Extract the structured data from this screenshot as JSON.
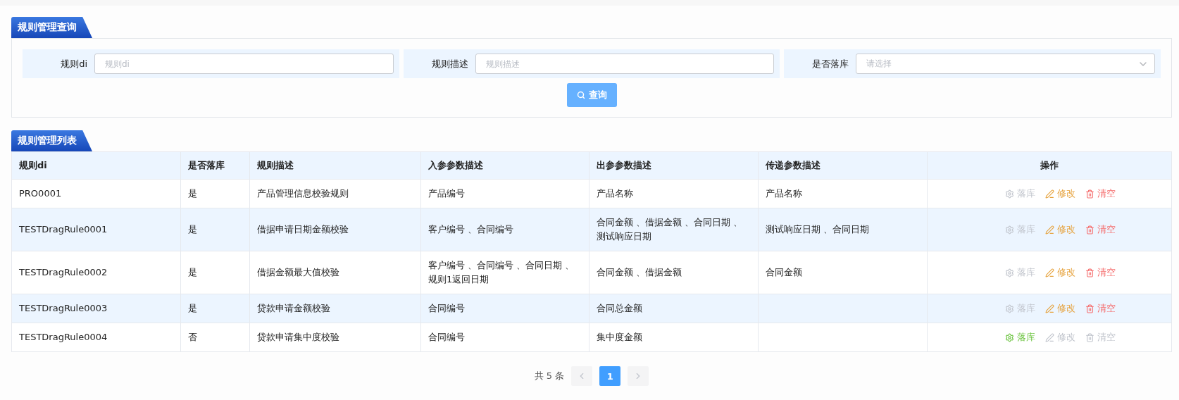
{
  "query_section": {
    "title": "规则管理查询",
    "fields": [
      {
        "kind": "input",
        "label": "规则di",
        "placeholder": "规则di"
      },
      {
        "kind": "input",
        "label": "规则描述",
        "placeholder": "规则描述"
      },
      {
        "kind": "select",
        "label": "是否落库",
        "placeholder": "请选择"
      }
    ],
    "search_button": "查询"
  },
  "list_section": {
    "title": "规则管理列表",
    "table": {
      "columns": [
        "规则di",
        "是否落库",
        "规则描述",
        "入参参数描述",
        "出参参数描述",
        "传递参数描述",
        "操作"
      ],
      "rows": [
        {
          "cells": [
            "PRO0001",
            "是",
            "产品管理信息校验规则",
            "产品编号",
            "产品名称",
            "产品名称"
          ],
          "actions": [
            {
              "kind": "store",
              "label": "落库",
              "disabled": true
            },
            {
              "kind": "edit",
              "label": "修改",
              "disabled": false
            },
            {
              "kind": "clear",
              "label": "清空",
              "disabled": false
            }
          ]
        },
        {
          "cells": [
            "TESTDragRule0001",
            "是",
            "借据申请日期金额校验",
            "客户编号 、合同编号",
            "合同金额 、借据金额 、合同日期 、测试响应日期",
            "测试响应日期 、合同日期"
          ],
          "actions": [
            {
              "kind": "store",
              "label": "落库",
              "disabled": true
            },
            {
              "kind": "edit",
              "label": "修改",
              "disabled": false
            },
            {
              "kind": "clear",
              "label": "清空",
              "disabled": false
            }
          ]
        },
        {
          "cells": [
            "TESTDragRule0002",
            "是",
            "借据金额最大值校验",
            "客户编号 、合同编号 、合同日期 、规则1返回日期",
            "合同金额 、借据金额",
            "合同金额"
          ],
          "actions": [
            {
              "kind": "store",
              "label": "落库",
              "disabled": true
            },
            {
              "kind": "edit",
              "label": "修改",
              "disabled": false
            },
            {
              "kind": "clear",
              "label": "清空",
              "disabled": false
            }
          ]
        },
        {
          "cells": [
            "TESTDragRule0003",
            "是",
            "贷款申请金额校验",
            "合同编号",
            "合同总金额",
            null
          ],
          "actions": [
            {
              "kind": "store",
              "label": "落库",
              "disabled": true
            },
            {
              "kind": "edit",
              "label": "修改",
              "disabled": false
            },
            {
              "kind": "clear",
              "label": "清空",
              "disabled": false
            }
          ]
        },
        {
          "cells": [
            "TESTDragRule0004",
            "否",
            "贷款申请集中度校验",
            "合同编号",
            "集中度金额",
            null
          ],
          "actions": [
            {
              "kind": "store",
              "label": "落库",
              "disabled": false
            },
            {
              "kind": "edit",
              "label": "修改",
              "disabled": true
            },
            {
              "kind": "clear",
              "label": "清空",
              "disabled": true
            }
          ]
        }
      ]
    },
    "pagination": {
      "total": "共 5 条",
      "prev_disabled": true,
      "next_disabled": true,
      "pages": [
        {
          "label": "1",
          "selected": true
        }
      ]
    }
  }
}
